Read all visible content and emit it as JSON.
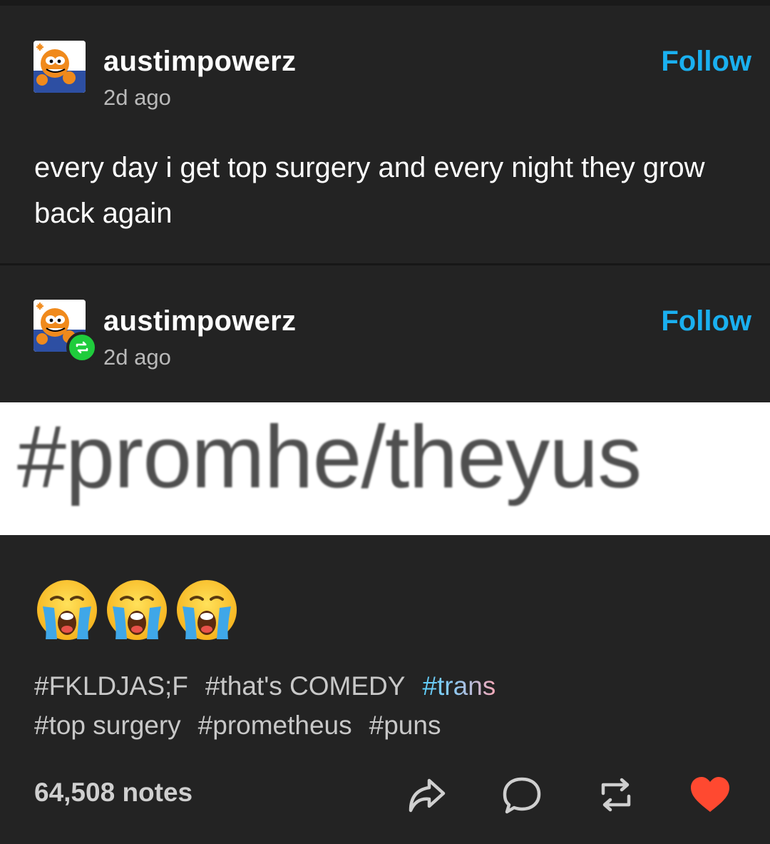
{
  "post1": {
    "username": "austimpowerz",
    "timestamp": "2d ago",
    "follow_label": "Follow",
    "body": "every day i get top surgery and every night they grow back again"
  },
  "post2": {
    "username": "austimpowerz",
    "timestamp": "2d ago",
    "follow_label": "Follow",
    "image_text": "#promhe/theyus",
    "emojis": [
      "loudly-crying-face",
      "loudly-crying-face",
      "loudly-crying-face"
    ]
  },
  "tags": [
    "#FKLDJAS;F",
    "#that's COMEDY",
    "#trans",
    "#top surgery",
    "#prometheus",
    "#puns"
  ],
  "footer": {
    "notes": "64,508 notes",
    "actions": [
      "share-icon",
      "reply-icon",
      "reblog-icon",
      "like-icon"
    ]
  },
  "colors": {
    "background": "#232323",
    "follow": "#1ab0f0",
    "reblog_badge": "#1fcc3c",
    "like": "#ff4930",
    "trans_flag_blue": "#5bcefa",
    "trans_flag_pink": "#f5a9b8"
  }
}
